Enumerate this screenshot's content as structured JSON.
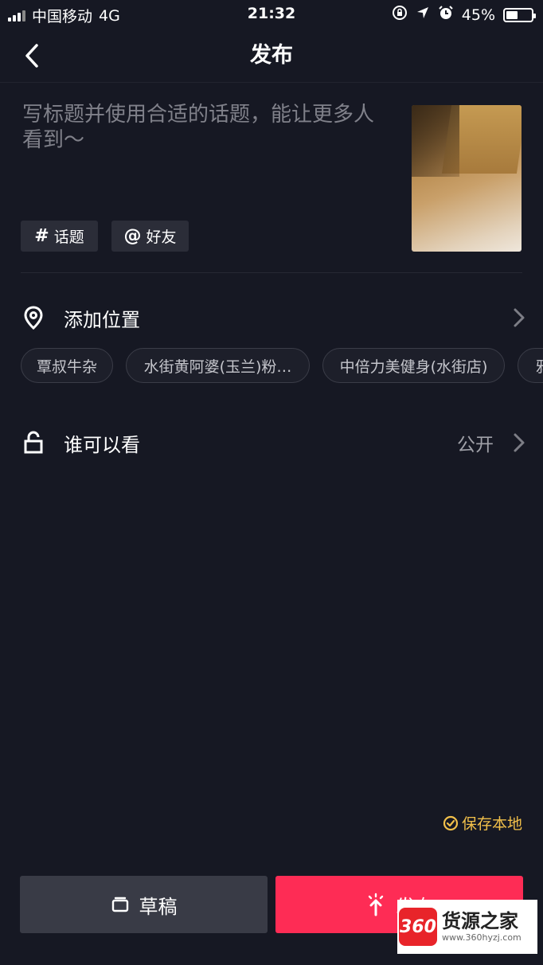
{
  "status_bar": {
    "carrier": "中国移动",
    "network": "4G",
    "time": "21:32",
    "battery_percent": "45%",
    "battery_level": 0.45
  },
  "nav": {
    "title": "发布"
  },
  "caption": {
    "placeholder": "写标题并使用合适的话题，能让更多人看到～"
  },
  "chips": {
    "topic_symbol": "#",
    "topic_label": "话题",
    "friend_symbol": "@",
    "friend_label": "好友"
  },
  "location": {
    "label": "添加位置",
    "suggestions": [
      "覃叔牛杂",
      "水街黄阿婆(玉兰)粉…",
      "中倍力美健身(水街店)",
      "鸦"
    ]
  },
  "visibility": {
    "label": "谁可以看",
    "value": "公开"
  },
  "save_local": {
    "label": "保存本地"
  },
  "actions": {
    "draft_label": "草稿",
    "publish_label": "发布"
  },
  "watermark": {
    "logo": "360",
    "name": "货源之家",
    "url": "www.360hyzj.com"
  },
  "colors": {
    "background": "#161823",
    "accent": "#fe2c55",
    "save_local": "#f2c04a"
  }
}
